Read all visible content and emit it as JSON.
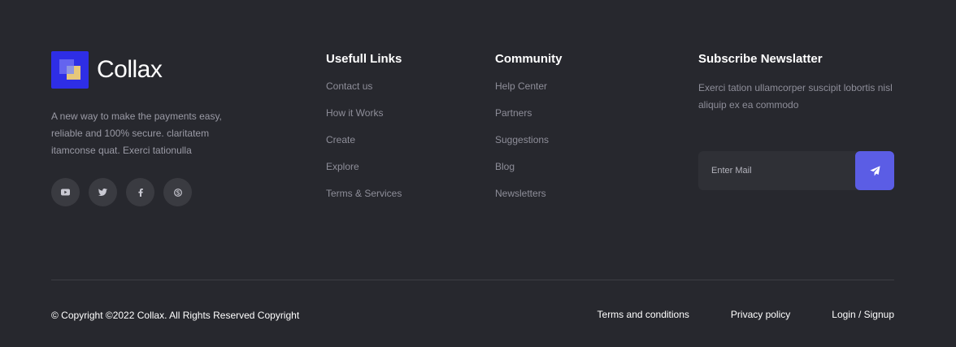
{
  "brand": {
    "name": "Collax"
  },
  "about": {
    "text": "A new way to make the payments easy, reliable and 100% secure. claritatem itamconse quat. Exerci tationulla"
  },
  "social": [
    {
      "icon": "youtube-icon"
    },
    {
      "icon": "twitter-icon"
    },
    {
      "icon": "facebook-icon"
    },
    {
      "icon": "skype-icon"
    }
  ],
  "columns": {
    "useful": {
      "title": "Usefull Links",
      "items": [
        "Contact us",
        "How it Works",
        "Create",
        "Explore",
        "Terms & Services"
      ]
    },
    "community": {
      "title": "Community",
      "items": [
        "Help Center",
        "Partners",
        "Suggestions",
        "Blog",
        "Newsletters"
      ]
    }
  },
  "newsletter": {
    "title": "Subscribe Newslatter",
    "text": "Exerci tation ullamcorper suscipit lobortis nisl aliquip ex ea commodo",
    "placeholder": "Enter Mail",
    "button_icon": "send-icon"
  },
  "bottom": {
    "copyright": "© Copyright ©2022 Collax. All Rights Reserved Copyright",
    "links": [
      "Terms and conditions",
      "Privacy policy",
      "Login / Signup"
    ]
  },
  "colors": {
    "background": "#27282e",
    "accent": "#5b5de5",
    "logo": "#2e2ee6"
  }
}
